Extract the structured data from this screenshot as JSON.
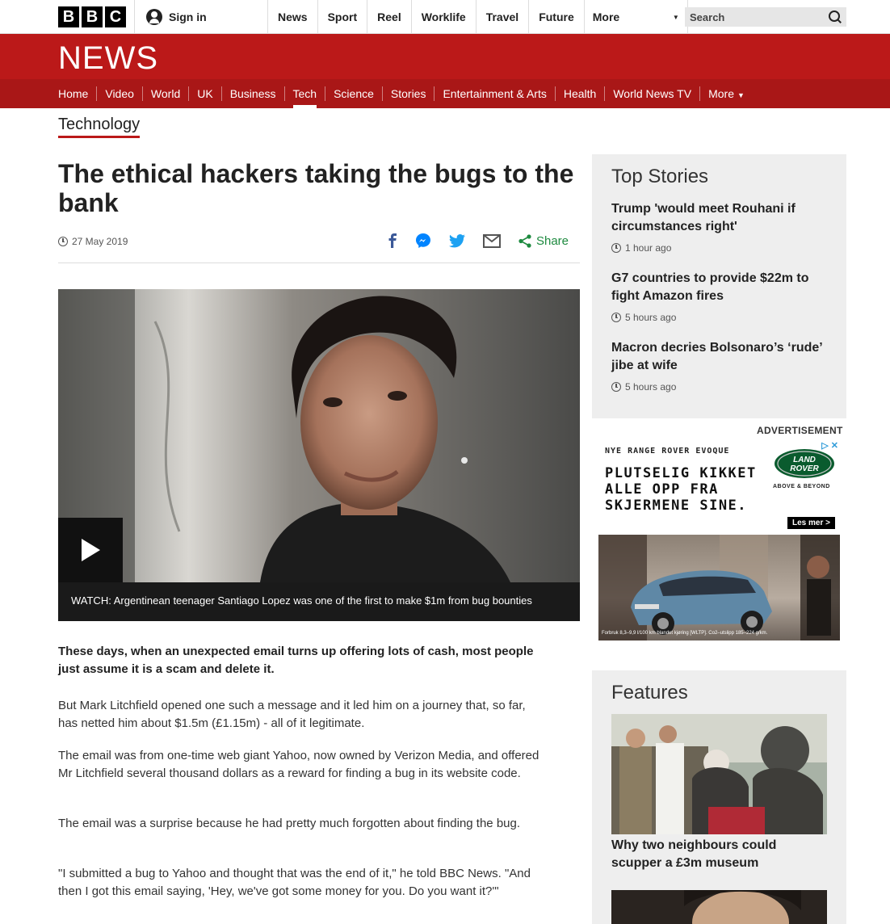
{
  "topbar": {
    "logo_letters": [
      "B",
      "B",
      "C"
    ],
    "signin_label": "Sign in",
    "nav": [
      "News",
      "Sport",
      "Reel",
      "Worklife",
      "Travel",
      "Future"
    ],
    "more_label": "More",
    "search_placeholder": "Search"
  },
  "brand": {
    "wordmark": "NEWS",
    "color": "#bb1919"
  },
  "section_nav": {
    "items": [
      "Home",
      "Video",
      "World",
      "UK",
      "Business",
      "Tech",
      "Science",
      "Stories",
      "Entertainment & Arts",
      "Health",
      "World News TV"
    ],
    "active": "Tech",
    "more_label": "More"
  },
  "section_label": "Technology",
  "article": {
    "headline": "The ethical hackers taking the bugs to the bank",
    "date": "27 May 2019",
    "share_label": "Share",
    "share_icons": [
      "facebook-icon",
      "messenger-icon",
      "twitter-icon",
      "email-icon",
      "share-icon"
    ],
    "video_caption": "WATCH: Argentinean teenager Santiago Lopez was one of the first to make $1m from bug bounties",
    "intro": "These days, when an unexpected email turns up offering lots of cash, most people just assume it is a scam and delete it.",
    "paragraphs": [
      "But Mark Litchfield opened one such a message and it led him on a journey that, so far, has netted him about $1.5m (£1.15m) - all of it legitimate.",
      "The email was from one-time web giant Yahoo, now owned by Verizon Media, and offered Mr Litchfield several thousand dollars as a reward for finding a bug in its website code.",
      "The email was a surprise because he had pretty much forgotten about finding the bug.",
      "\"I submitted a bug to Yahoo and thought that was the end of it,\" he told BBC News. \"And then I got this email saying, 'Hey, we've got some money for you. Do you want it?'\""
    ]
  },
  "top_stories": {
    "title": "Top Stories",
    "items": [
      {
        "title": "Trump 'would meet Rouhani if circumstances right'",
        "time": "1 hour ago"
      },
      {
        "title": "G7 countries to provide $22m to fight Amazon fires",
        "time": "5 hours ago"
      },
      {
        "title": "Macron decries Bolsonaro’s ‘rude’ jibe at wife",
        "time": "5 hours ago"
      }
    ]
  },
  "advert": {
    "label": "ADVERTISEMENT",
    "kicker": "NYE RANGE ROVER EVOQUE",
    "headline": "PLUTSELIG KIKKET ALLE OPP FRA SKJERMENE SINE.",
    "logo_text_1": "LAND",
    "logo_text_2": "ROVER",
    "tagline": "ABOVE & BEYOND",
    "cta": "Les mer >",
    "fine_print": "Forbruk 8,3–9,9 l/100 km blandet kjøring [WLTP]. Co2–utslipp 185–224 g/km."
  },
  "features": {
    "title": "Features",
    "items": [
      {
        "title": "Why two neighbours could scupper a £3m museum"
      }
    ]
  }
}
